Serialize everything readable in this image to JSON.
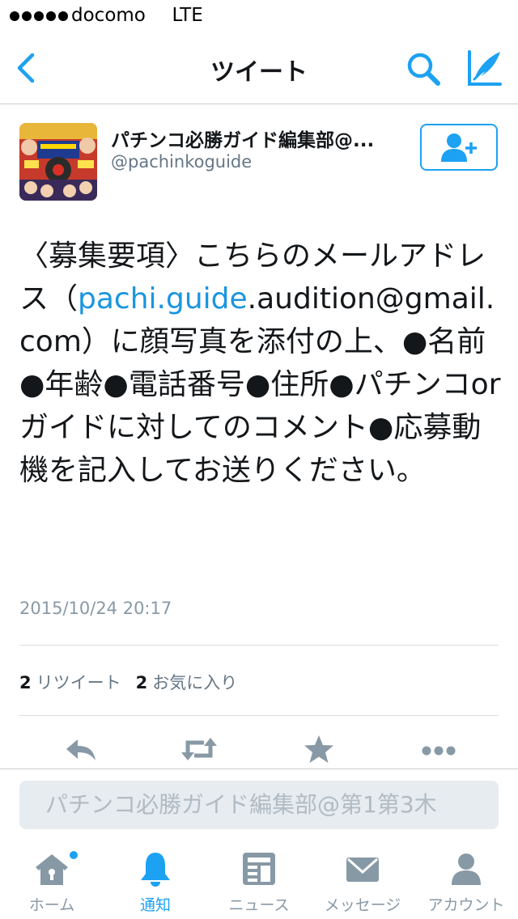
{
  "status_bar": {
    "carrier": "docomo",
    "network": "LTE"
  },
  "nav": {
    "title": "ツイート"
  },
  "user": {
    "name": "パチンコ必勝ガイド編集部@...",
    "handle": "@pachinkoguide"
  },
  "tweet": {
    "text_before_link": "〈募集要項〉こちらのメールアドレス（",
    "link_text": "pachi.guide",
    "text_after_link": ".audition@gmail.com）に顔写真を添付の上、●名前●年齢●電話番号●住所●パチンコorガイドに対してのコメント●応募動機を記入してお送りください。",
    "timestamp": "2015/10/24 20:17"
  },
  "stats": {
    "retweets_count": "2",
    "retweets_label": "リツイート",
    "favorites_count": "2",
    "favorites_label": "お気に入り"
  },
  "reply": {
    "placeholder": "パチンコ必勝ガイド編集部@第1第3木"
  },
  "tabs": [
    {
      "label": "ホーム",
      "icon": "home-icon"
    },
    {
      "label": "通知",
      "icon": "bell-icon"
    },
    {
      "label": "ニュース",
      "icon": "news-icon"
    },
    {
      "label": "メッセージ",
      "icon": "envelope-icon"
    },
    {
      "label": "アカウント",
      "icon": "person-icon"
    }
  ],
  "colors": {
    "accent": "#1da1f2",
    "icon_gray": "#8899a6",
    "link": "#1b95e0"
  }
}
